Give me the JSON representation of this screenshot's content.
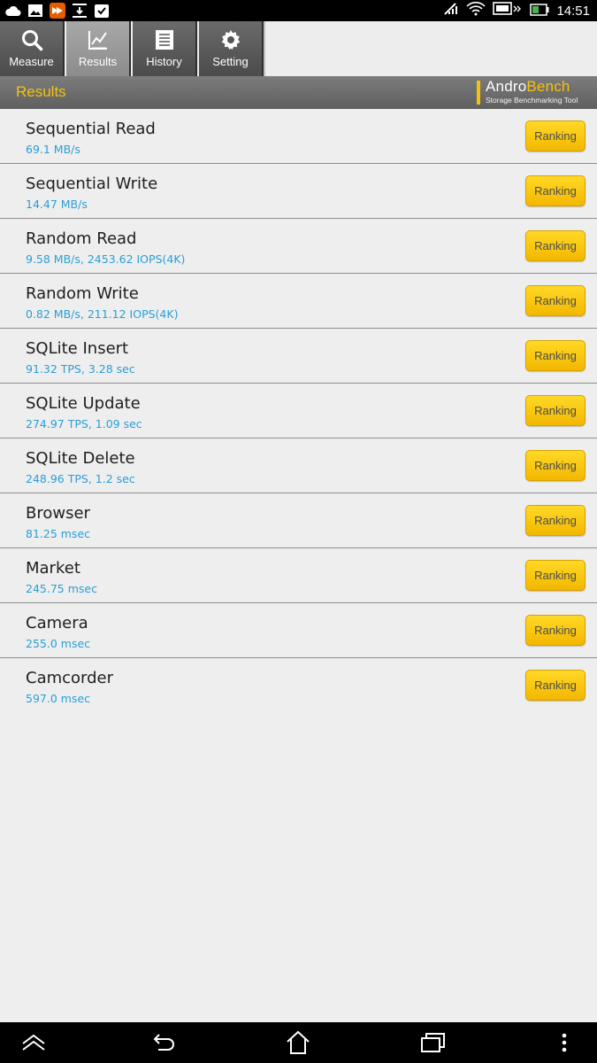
{
  "status_bar": {
    "time": "14:51",
    "left_icons": [
      "cloud-icon",
      "gallery-icon",
      "app-icon",
      "download-icon",
      "task-done-icon"
    ],
    "right_icons": [
      "no-signal-icon",
      "wifi-icon",
      "screen-mirror-icon",
      "battery-icon"
    ]
  },
  "tabs": [
    {
      "label": "Measure",
      "icon": "search-icon",
      "active": false
    },
    {
      "label": "Results",
      "icon": "chart-icon",
      "active": true
    },
    {
      "label": "History",
      "icon": "list-icon",
      "active": false
    },
    {
      "label": "Setting",
      "icon": "gear-icon",
      "active": false
    }
  ],
  "header": {
    "title": "Results",
    "logo_andro": "Andro",
    "logo_bench": "Bench",
    "logo_sub": "Storage Benchmarking Tool"
  },
  "results": [
    {
      "name": "Sequential Read",
      "value": "69.1 MB/s",
      "button": "Ranking"
    },
    {
      "name": "Sequential Write",
      "value": "14.47 MB/s",
      "button": "Ranking"
    },
    {
      "name": "Random Read",
      "value": "9.58 MB/s, 2453.62 IOPS(4K)",
      "button": "Ranking"
    },
    {
      "name": "Random Write",
      "value": "0.82 MB/s, 211.12 IOPS(4K)",
      "button": "Ranking"
    },
    {
      "name": "SQLite Insert",
      "value": "91.32 TPS, 3.28 sec",
      "button": "Ranking"
    },
    {
      "name": "SQLite Update",
      "value": "274.97 TPS, 1.09 sec",
      "button": "Ranking"
    },
    {
      "name": "SQLite Delete",
      "value": "248.96 TPS, 1.2 sec",
      "button": "Ranking"
    },
    {
      "name": "Browser",
      "value": "81.25 msec",
      "button": "Ranking"
    },
    {
      "name": "Market",
      "value": "245.75 msec",
      "button": "Ranking"
    },
    {
      "name": "Camera",
      "value": "255.0 msec",
      "button": "Ranking"
    },
    {
      "name": "Camcorder",
      "value": "597.0 msec",
      "button": "Ranking"
    }
  ],
  "nav": [
    "hide-icon",
    "back-icon",
    "home-icon",
    "recents-icon",
    "menu-icon"
  ],
  "colors": {
    "accent": "#f4c20d",
    "value_text": "#2a9fd6",
    "button": "#ffd927"
  }
}
